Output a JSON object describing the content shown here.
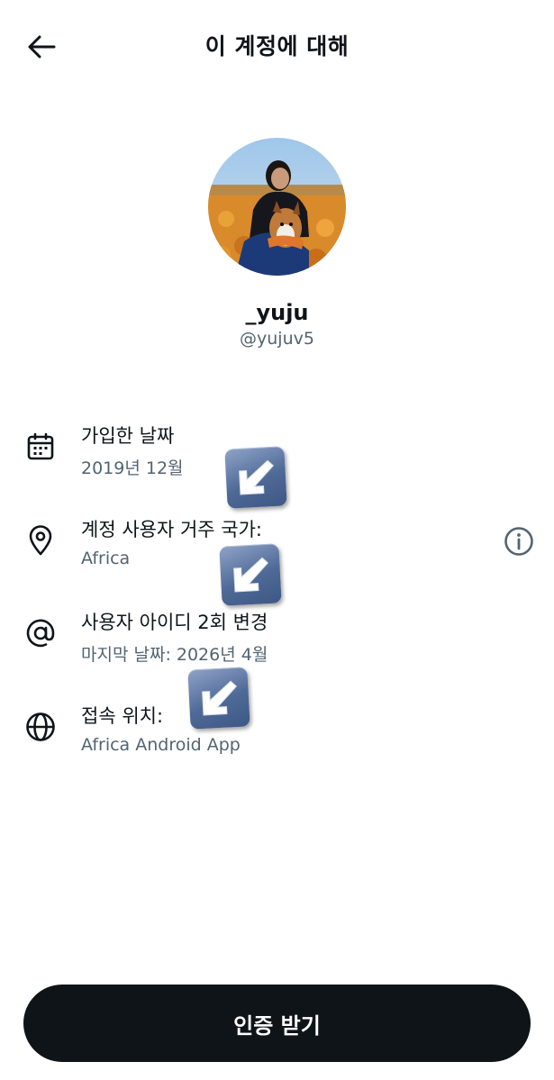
{
  "header": {
    "title": "이 계정에 대해",
    "back_icon": "arrow-left-icon"
  },
  "profile": {
    "display_name": "_yuju",
    "handle": "@yujuv5",
    "avatar_desc_icon": "avatar-photo"
  },
  "info_rows": [
    {
      "icon": "calendar-icon",
      "label": "가입한 날짜",
      "value": "2019년 12월"
    },
    {
      "icon": "location-pin-icon",
      "label": "계정 사용자 거주 국가:",
      "value": "Africa"
    },
    {
      "icon": "at-sign-icon",
      "label": "사용자 아이디 2회 변경",
      "value": "마지막 날짜: 2026년 4월"
    },
    {
      "icon": "globe-icon",
      "label": "접속 위치:",
      "value": "Africa Android App"
    }
  ],
  "info_button_icon": "info-circle-icon",
  "cta": {
    "label": "인증 받기"
  },
  "colors": {
    "text_primary": "#0f1419",
    "text_secondary": "#536471",
    "button_bg": "#0f1419",
    "button_text": "#ffffff",
    "sticker_blue": "#4f6a97"
  }
}
